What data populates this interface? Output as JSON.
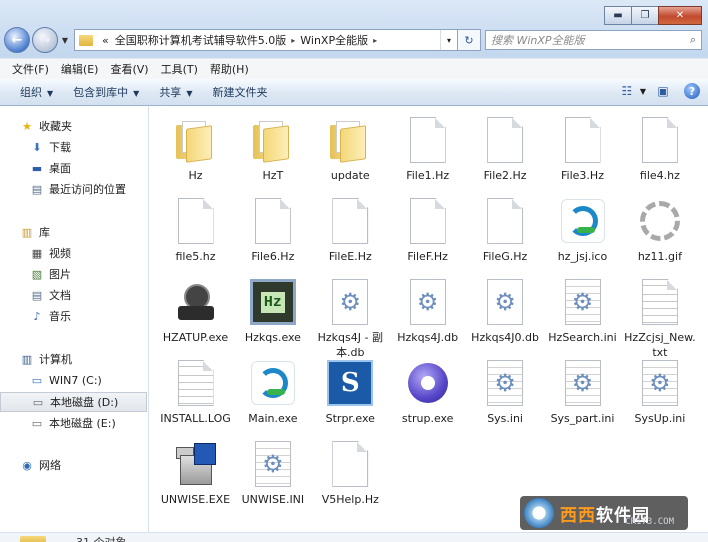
{
  "window": {
    "minimize": "▬",
    "maximize": "❐",
    "close": "✕"
  },
  "address": {
    "overflow": "«",
    "segments": [
      "全国职称计算机考试辅导软件5.0版",
      "WinXP全能版"
    ],
    "separator": "▸",
    "dropdown": "▾",
    "refresh": "↻",
    "search_placeholder": "搜索 WinXP全能版",
    "search_icon": "⌕"
  },
  "menu": [
    "文件(F)",
    "编辑(E)",
    "查看(V)",
    "工具(T)",
    "帮助(H)"
  ],
  "toolbar": {
    "organize": "组织",
    "include": "包含到库中",
    "share": "共享",
    "new_folder": "新建文件夹",
    "arrow": "▼",
    "view_icon": "☷",
    "pane_icon": "▣",
    "help_icon": "?"
  },
  "nav": {
    "favorites": "收藏夹",
    "downloads": "下载",
    "desktop": "桌面",
    "recent": "最近访问的位置",
    "libraries": "库",
    "videos": "视频",
    "pictures": "图片",
    "documents": "文档",
    "music": "音乐",
    "computer": "计算机",
    "drive_c": "WIN7 (C:)",
    "drive_d": "本地磁盘 (D:)",
    "drive_e": "本地磁盘 (E:)",
    "network": "网络"
  },
  "files": [
    {
      "name": "Hz",
      "type": "folder"
    },
    {
      "name": "HzT",
      "type": "folder"
    },
    {
      "name": "update",
      "type": "folder"
    },
    {
      "name": "File1.Hz",
      "type": "doc"
    },
    {
      "name": "File2.Hz",
      "type": "doc"
    },
    {
      "name": "File3.Hz",
      "type": "doc"
    },
    {
      "name": "file4.hz",
      "type": "doc"
    },
    {
      "name": "file5.hz",
      "type": "doc"
    },
    {
      "name": "File6.Hz",
      "type": "doc"
    },
    {
      "name": "FileE.Hz",
      "type": "doc"
    },
    {
      "name": "FileF.Hz",
      "type": "doc"
    },
    {
      "name": "FileG.Hz",
      "type": "doc"
    },
    {
      "name": "hz_jsj.ico",
      "type": "main"
    },
    {
      "name": "hz11.gif",
      "type": "spin"
    },
    {
      "name": "HZATUP.exe",
      "type": "satellite"
    },
    {
      "name": "Hzkqs.exe",
      "type": "hz"
    },
    {
      "name": "Hzkqs4J - 副本.db",
      "type": "gear"
    },
    {
      "name": "Hzkqs4J.db",
      "type": "gear"
    },
    {
      "name": "Hzkqs4J0.db",
      "type": "gear"
    },
    {
      "name": "HzSearch.ini",
      "type": "gearpage"
    },
    {
      "name": "HzZcjsj_New.txt",
      "type": "txt"
    },
    {
      "name": "INSTALL.LOG",
      "type": "txt"
    },
    {
      "name": "Main.exe",
      "type": "main"
    },
    {
      "name": "Strpr.exe",
      "type": "strpr"
    },
    {
      "name": "strup.exe",
      "type": "strup"
    },
    {
      "name": "Sys.ini",
      "type": "gearpage"
    },
    {
      "name": "Sys_part.ini",
      "type": "gearpage"
    },
    {
      "name": "SysUp.ini",
      "type": "gearpage"
    },
    {
      "name": "UNWISE.EXE",
      "type": "setup"
    },
    {
      "name": "UNWISE.INI",
      "type": "gearpage"
    },
    {
      "name": "V5Help.Hz",
      "type": "doc"
    }
  ],
  "status": {
    "count": "31 个对象"
  },
  "watermark": {
    "brand_a": "西西",
    "brand_b": "软件园",
    "url": "CR173.COM"
  }
}
